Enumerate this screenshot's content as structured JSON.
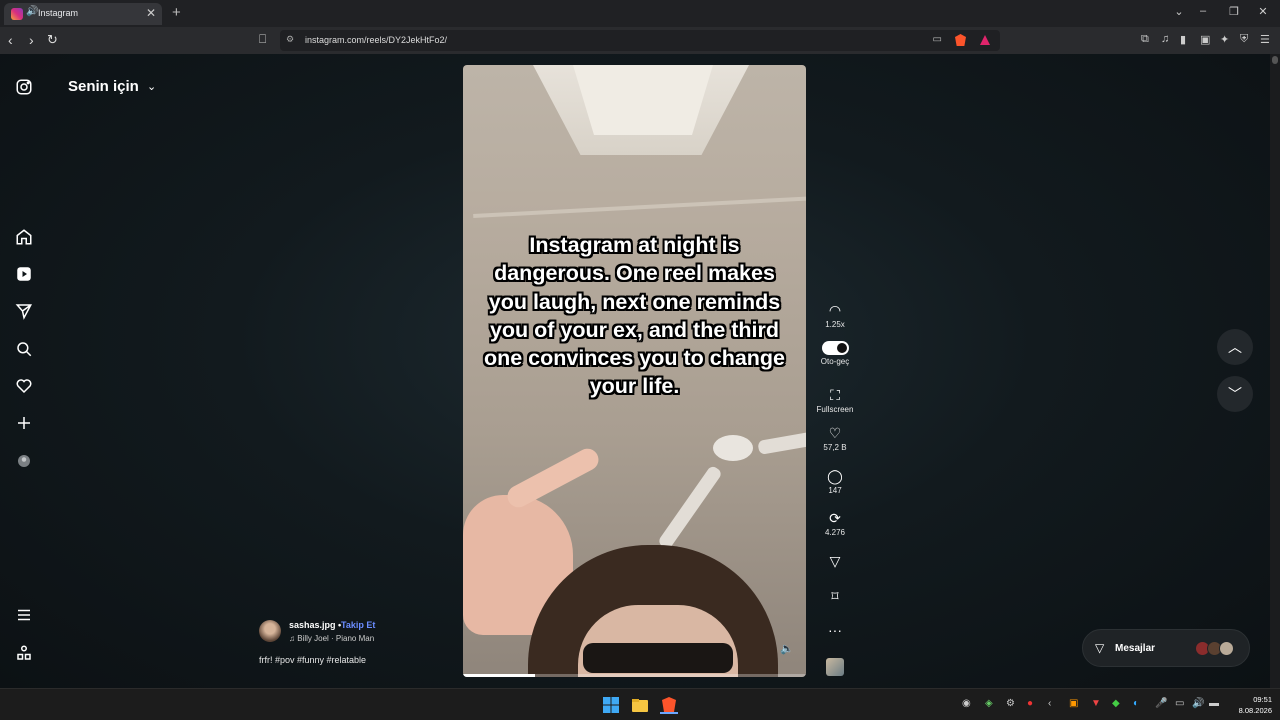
{
  "browser": {
    "tab_title": "Instagram",
    "url": "instagram.com/reels/DY2JekHtFo2/",
    "new_tab": "+",
    "tab_close": "✕"
  },
  "sidebar": {
    "feed_title": "Senin için",
    "items": [
      "home",
      "reels",
      "messages",
      "search",
      "notifications",
      "create",
      "profile"
    ]
  },
  "reel": {
    "caption_overlay": "Instagram at night is dangerous. One reel makes you laugh, next one reminds you of your ex, and the third one convinces you to change your life.",
    "progress": 0.21,
    "author": "sashas.jpg",
    "follow_label": "Takip Et",
    "separator": "•",
    "music": "Billy Joel · Piano Man",
    "post_caption": "frfr! #pov #funny #relatable"
  },
  "actions": {
    "speed": "1.25x",
    "autoplay_label": "Oto-geç",
    "autoplay_on": true,
    "fullscreen_label": "Fullscreen",
    "likes": "57,2 B",
    "comments": "147",
    "reposts": "4.276"
  },
  "messages": {
    "label": "Mesajlar"
  },
  "taskbar": {
    "time": "09:51",
    "date": "8.08.2026"
  },
  "colors": {
    "accent_link": "#6a8cff",
    "brave": "#fb542b"
  }
}
